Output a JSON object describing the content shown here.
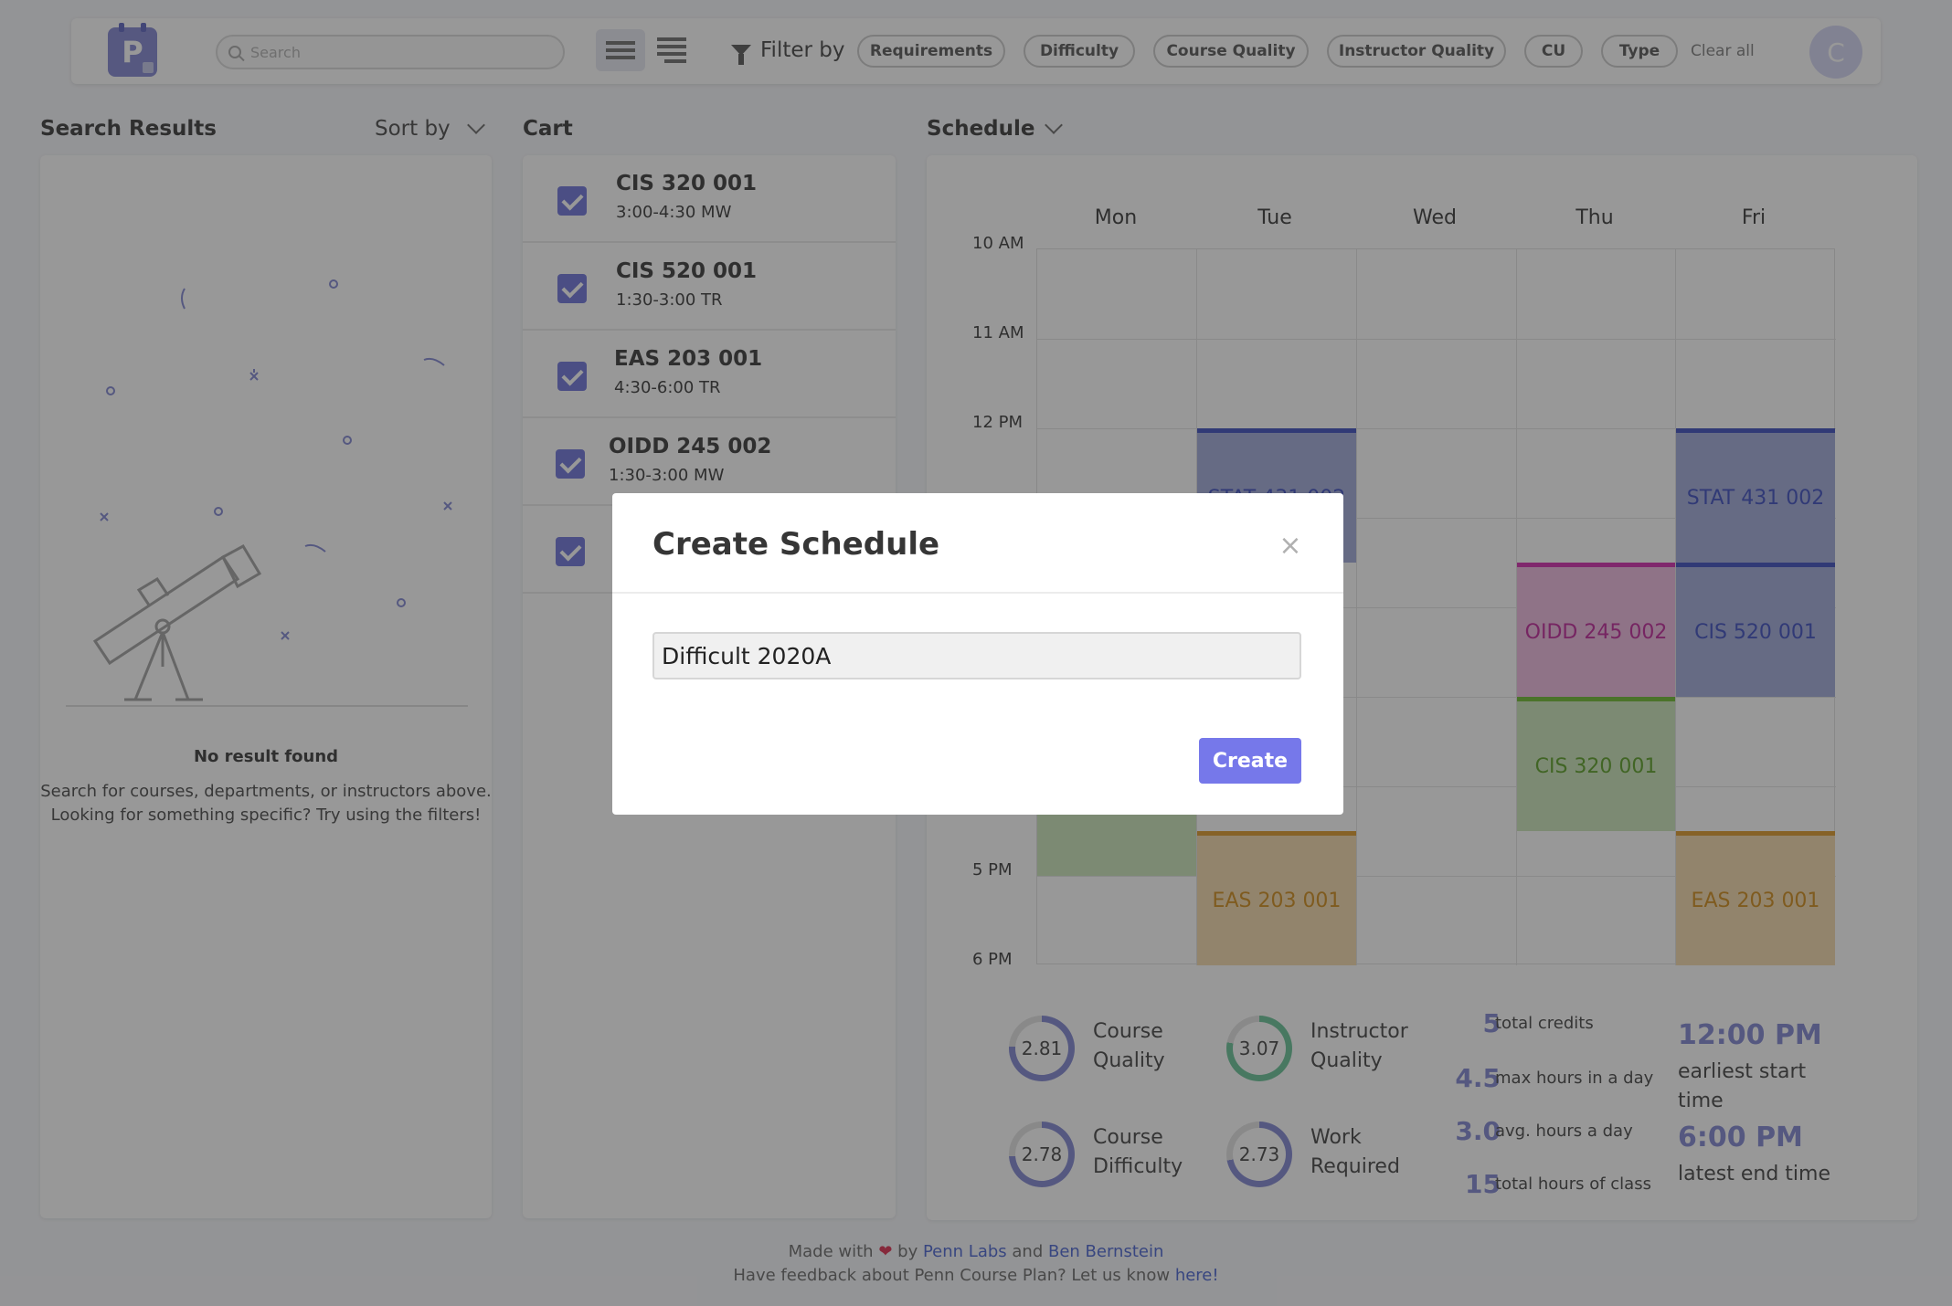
{
  "navbar": {
    "logo_letter": "P",
    "search_placeholder": "Search",
    "filter_label": "Filter by",
    "filters": [
      "Requirements",
      "Difficulty",
      "Course Quality",
      "Instructor Quality",
      "CU",
      "Type"
    ],
    "clear_all": "Clear all",
    "avatar_initial": "C"
  },
  "search_results": {
    "title": "Search Results",
    "sort_label": "Sort by",
    "empty_title": "No result found",
    "empty_line1": "Search for courses, departments, or instructors above.",
    "empty_line2": "Looking for something specific? Try using the filters!"
  },
  "cart": {
    "title": "Cart",
    "items": [
      {
        "name": "CIS 320 001",
        "time": "3:00-4:30 MW",
        "checked": true
      },
      {
        "name": "CIS 520 001",
        "time": "1:30-3:00 TR",
        "checked": true
      },
      {
        "name": "EAS 203 001",
        "time": "4:30-6:00 TR",
        "checked": true
      },
      {
        "name": "OIDD 245 002",
        "time": "1:30-3:00 MW",
        "checked": true
      },
      {
        "name": "",
        "time": "",
        "checked": true
      }
    ]
  },
  "schedule": {
    "title": "Schedule",
    "days": [
      "Mon",
      "Tue",
      "Wed",
      "Thu",
      "Fri"
    ],
    "hours": [
      "10 AM",
      "11 AM",
      "12 PM",
      "5 PM",
      "6 PM"
    ],
    "blocks": [
      {
        "label": "STAT 431 002",
        "color": "#aab1dd"
      },
      {
        "label": "STAT 431 002",
        "color": "#aab1dd"
      },
      {
        "label": "OIDD 245 002",
        "color": "#f0bfe2"
      },
      {
        "label": "CIS 520 001",
        "color": "#aab1dd"
      },
      {
        "label": "CIS 320 001",
        "color": "#cfe7bf"
      },
      {
        "label": "EAS 203 001",
        "color": "#f5ddb4"
      },
      {
        "label": "EAS 203 001",
        "color": "#f5ddb4"
      },
      {
        "label": "",
        "color": "#cfe7bf"
      }
    ],
    "stats": {
      "course_quality": {
        "value": "2.81",
        "label1": "Course",
        "label2": "Quality"
      },
      "instructor_quality": {
        "value": "3.07",
        "label1": "Instructor",
        "label2": "Quality"
      },
      "course_difficulty": {
        "value": "2.78",
        "label1": "Course",
        "label2": "Difficulty"
      },
      "work_required": {
        "value": "2.73",
        "label1": "Work",
        "label2": "Required"
      },
      "total_credits": {
        "value": "5",
        "label": "total credits"
      },
      "max_hours": {
        "value": "4.5",
        "label": "max hours in a day"
      },
      "avg_hours": {
        "value": "3.0",
        "label": "avg. hours a day"
      },
      "total_hours": {
        "value": "15",
        "label": "total hours of class"
      },
      "earliest_start": {
        "value": "12:00 PM",
        "label1": "earliest start",
        "label2": "time"
      },
      "latest_end": {
        "value": "6:00 PM",
        "label": "latest end time"
      }
    }
  },
  "footer": {
    "made_with": "Made with",
    "by": "by",
    "penn_labs": "Penn Labs",
    "and": "and",
    "ben": "Ben Bernstein",
    "feedback": "Have feedback about Penn Course Plan? Let us know",
    "here": "here!"
  },
  "modal": {
    "title": "Create Schedule",
    "close": "×",
    "input_value": "Difficult 2020A",
    "create_label": "Create"
  }
}
